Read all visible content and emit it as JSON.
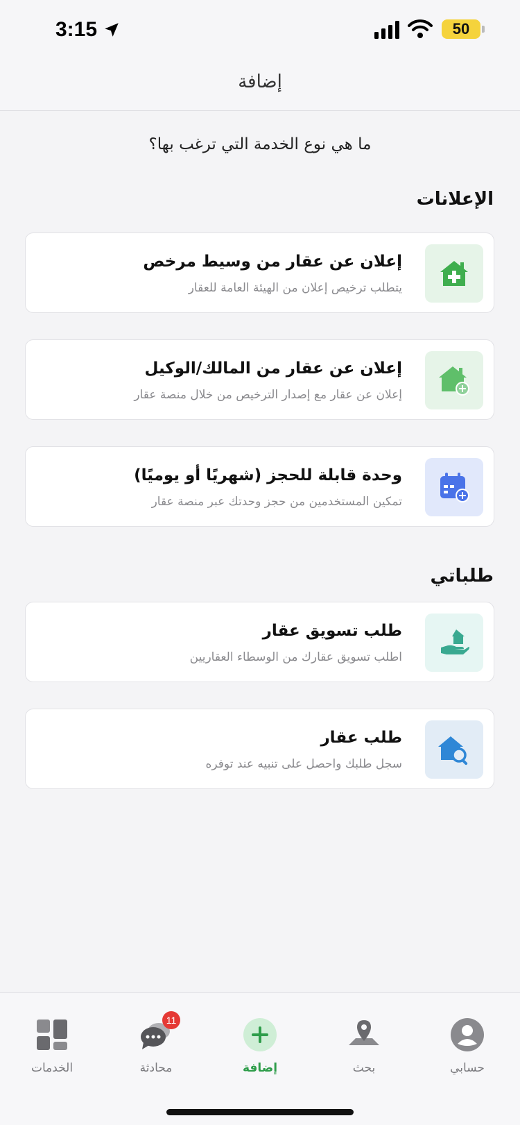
{
  "status": {
    "time": "3:15",
    "battery": "50"
  },
  "header": {
    "title": "إضافة"
  },
  "question": "ما هي نوع الخدمة التي ترغب بها؟",
  "sections": {
    "ads": {
      "title": "الإعلانات",
      "items": [
        {
          "title": "إعلان عن عقار من وسيط مرخص",
          "subtitle": "يتطلب ترخيص إعلان من الهيئة العامة للعقار",
          "icon": "house-plus-icon",
          "icon_bg": "#e6f4e8",
          "icon_color": "#3fae4e"
        },
        {
          "title": "إعلان عن عقار من المالك/الوكيل",
          "subtitle": "إعلان عن عقار مع إصدار الترخيص من خلال منصة عقار",
          "icon": "house-add-badge-icon",
          "icon_bg": "#e6f4e8",
          "icon_color": "#5fbf6a"
        },
        {
          "title": "وحدة قابلة للحجز (شهريًا أو يوميًا)",
          "subtitle": "تمكين المستخدمين من حجز وحدتك عبر منصة عقار",
          "icon": "calendar-add-icon",
          "icon_bg": "#e1e8fb",
          "icon_color": "#4a73e8"
        }
      ]
    },
    "requests": {
      "title": "طلباتي",
      "items": [
        {
          "title": "طلب تسويق عقار",
          "subtitle": "اطلب تسويق عقارك من الوسطاء العقاريين",
          "icon": "hand-house-icon",
          "icon_bg": "#e6f6f3",
          "icon_color": "#39a990"
        },
        {
          "title": "طلب عقار",
          "subtitle": "سجل طلبك واحصل على تنبيه عند توفره",
          "icon": "house-search-icon",
          "icon_bg": "#e2ecf6",
          "icon_color": "#2f87d6"
        }
      ]
    }
  },
  "tabs": [
    {
      "label": "حسابي",
      "icon": "profile-icon"
    },
    {
      "label": "بحث",
      "icon": "map-pin-icon"
    },
    {
      "label": "إضافة",
      "icon": "add-circle-icon",
      "active": true
    },
    {
      "label": "محادثة",
      "icon": "chat-icon",
      "badge": "11"
    },
    {
      "label": "الخدمات",
      "icon": "services-grid-icon"
    }
  ],
  "colors": {
    "accent": "#2e9d4a",
    "badge": "#e53935"
  }
}
